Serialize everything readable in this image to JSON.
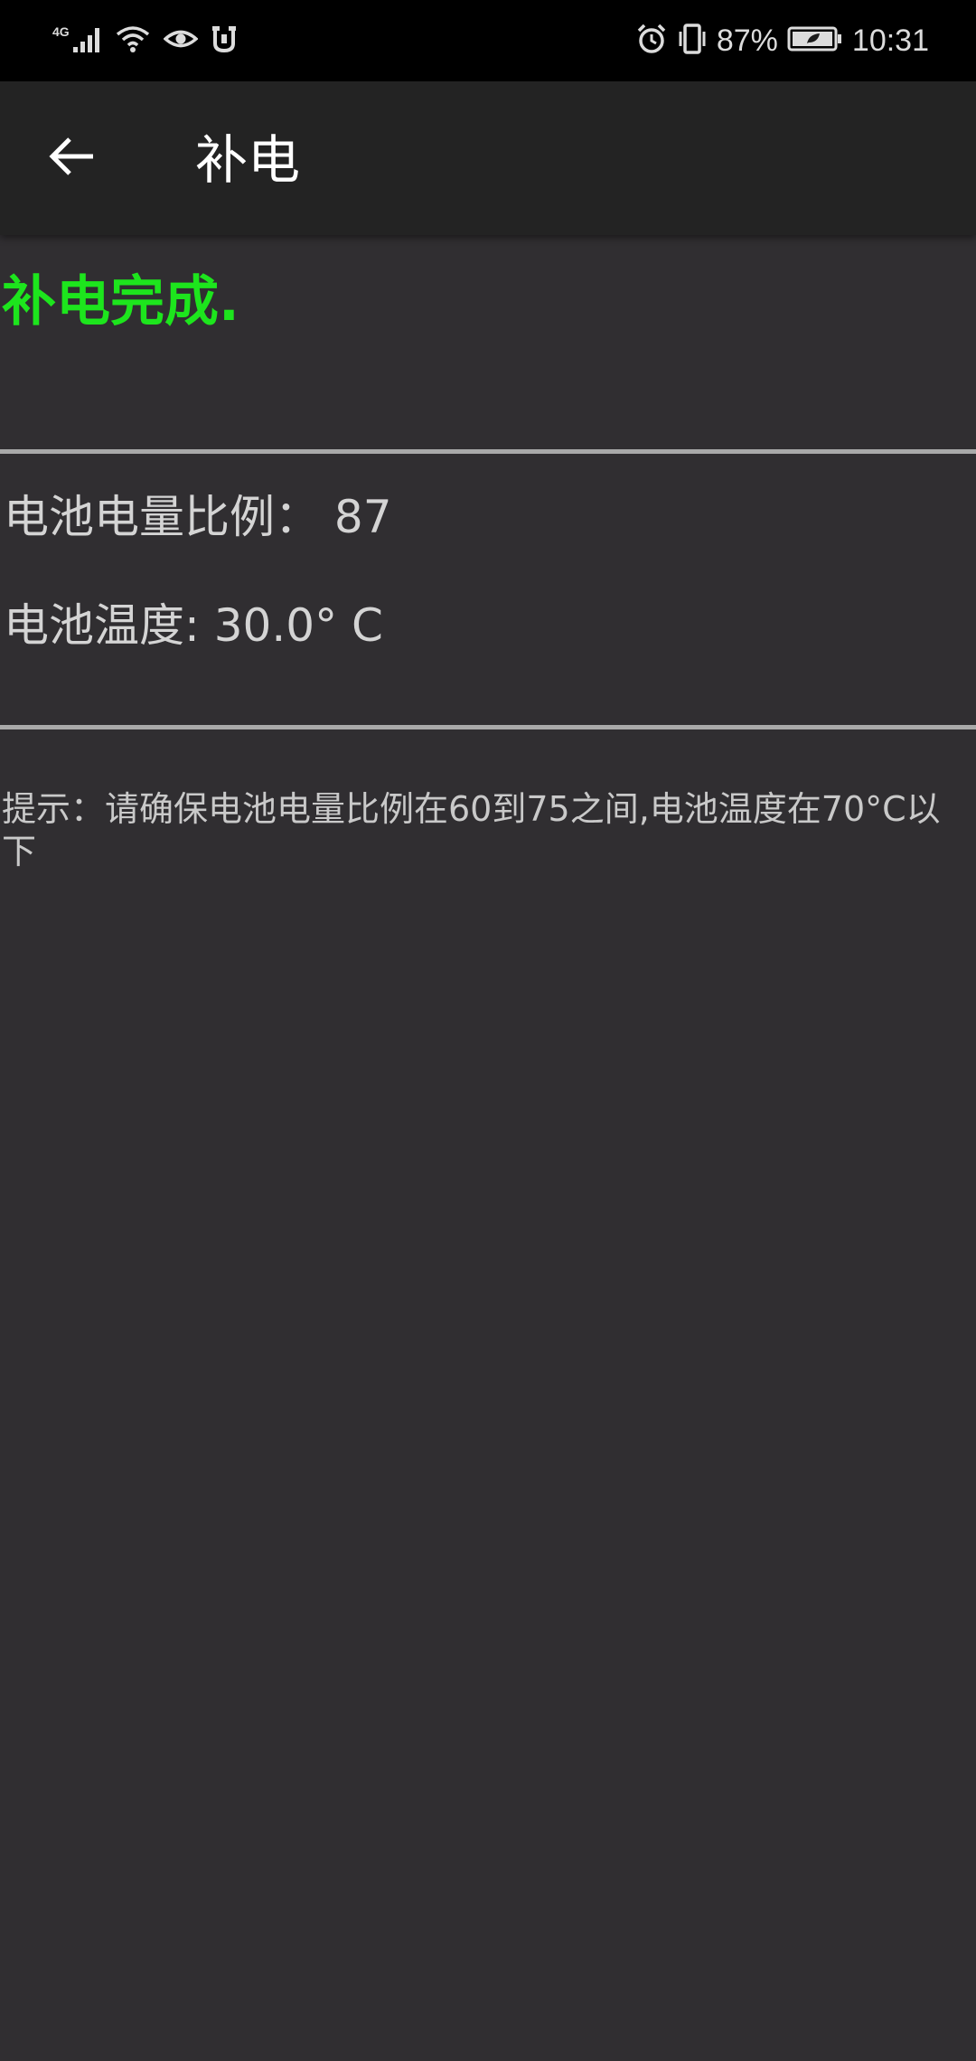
{
  "status_bar": {
    "network_label": "4G",
    "battery_percent": "87%",
    "time": "10:31",
    "left_icons": [
      "signal-icon",
      "wifi-icon",
      "eye-comfort-icon",
      "vpn-icon"
    ],
    "right_icons": [
      "alarm-icon",
      "vibrate-icon",
      "battery-icon"
    ]
  },
  "app_bar": {
    "title": "补电"
  },
  "main": {
    "status_message": "补电完成.",
    "battery_level_line": "电池电量比例：  87",
    "battery_temp_line": "电池温度: 30.0° C",
    "hint": "提示：请确保电池电量比例在60到75之间,电池温度在70°C以下"
  },
  "colors": {
    "status_ok": "#1de51d",
    "background": "#302e31",
    "app_bar": "#232323",
    "divider": "#a9a9a9"
  }
}
